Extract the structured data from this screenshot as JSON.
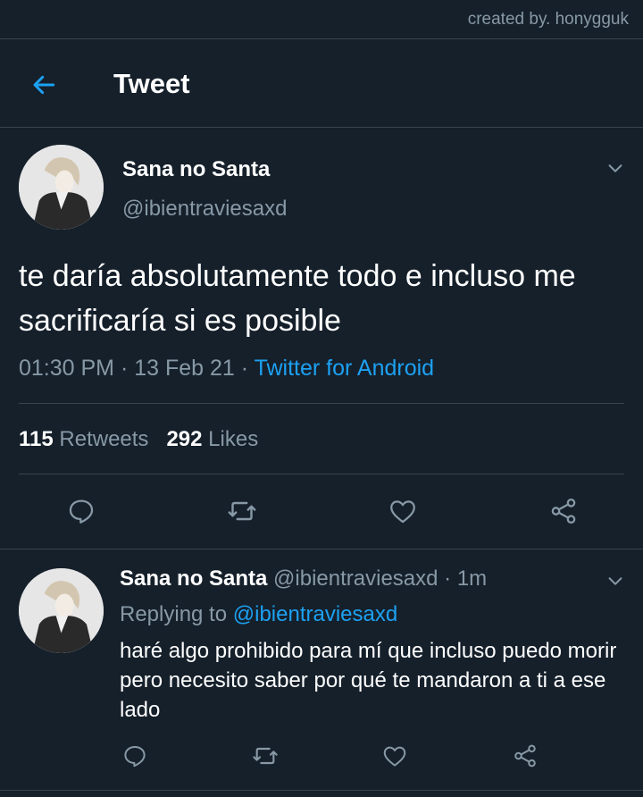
{
  "watermark": "created by. honygguk",
  "header": {
    "title": "Tweet",
    "back_icon": "arrow-left-icon"
  },
  "tweet": {
    "author_name": "Sana no Santa",
    "author_handle": "@ibientraviesaxd",
    "text": "te daría absolutamente todo e incluso me sacrificaría si es posible",
    "time": "01:30 PM",
    "date": "13 Feb 21",
    "separator": " · ",
    "source": "Twitter for Android",
    "retweets_count": "115",
    "retweets_label": "Retweets",
    "likes_count": "292",
    "likes_label": "Likes"
  },
  "reply": {
    "author_name": "Sana no Santa",
    "author_handle": "@ibientraviesaxd",
    "time_ago": " · 1m",
    "replying_prefix": "Replying to ",
    "replying_handle": "@ibientraviesaxd",
    "text": "haré algo prohibido para mí que incluso puedo morir pero necesito saber por qué te mandaron a ti a ese lado"
  },
  "colors": {
    "background": "#15202b",
    "accent": "#1da1f2",
    "secondary_text": "#8899a6",
    "divider": "#38444d"
  }
}
